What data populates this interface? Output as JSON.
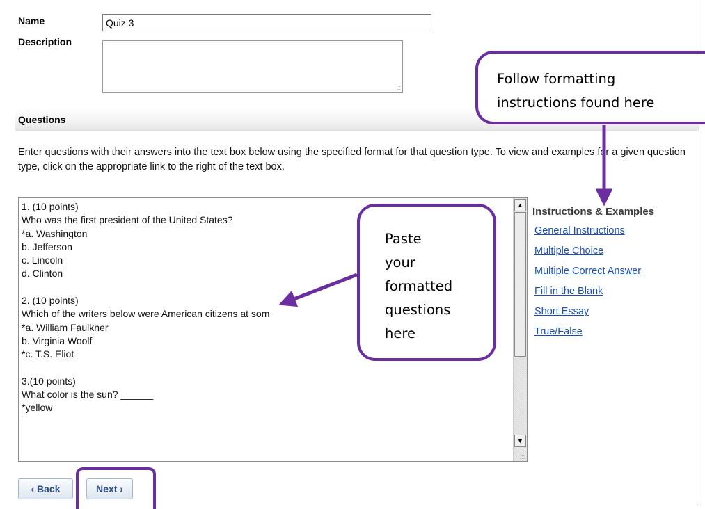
{
  "form": {
    "name_label": "Name",
    "name_value": "Quiz 3",
    "description_label": "Description",
    "description_value": ""
  },
  "questions_header": "Questions",
  "help_text": "Enter questions with their answers into the text box below using the specified format for that question type. To view and examples for a given question type, click on the appropriate link to the right of the text box.",
  "questions_text": "1. (10 points)\nWho was the first president of the United States?\n*a. Washington\nb. Jefferson\nc. Lincoln\nd. Clinton\n\n2. (10 points)\nWhich of the writers below were American citizens at som\n*a. William Faulkner\nb. Virginia Woolf\n*c. T.S. Eliot\n\n3.(10 points)\nWhat color is the sun? ______\n*yellow",
  "instructions": {
    "title": "Instructions & Examples",
    "links": [
      "General Instructions",
      "Multiple Choice",
      "Multiple Correct Answer",
      "Fill in the Blank",
      "Short Essay",
      "True/False"
    ]
  },
  "buttons": {
    "back": "‹ Back",
    "next": "Next ›"
  },
  "callouts": {
    "top_right": "Follow formatting\ninstructions found here",
    "center": "Paste\nyour\nformatted\nquestions\nhere"
  },
  "colors": {
    "callout_border": "#6a2ea0",
    "link": "#1b4fb8",
    "button_text": "#2a4c86"
  },
  "icons": [
    "scroll-up-arrow-icon",
    "scroll-down-arrow-icon",
    "resize-grip-icon"
  ]
}
